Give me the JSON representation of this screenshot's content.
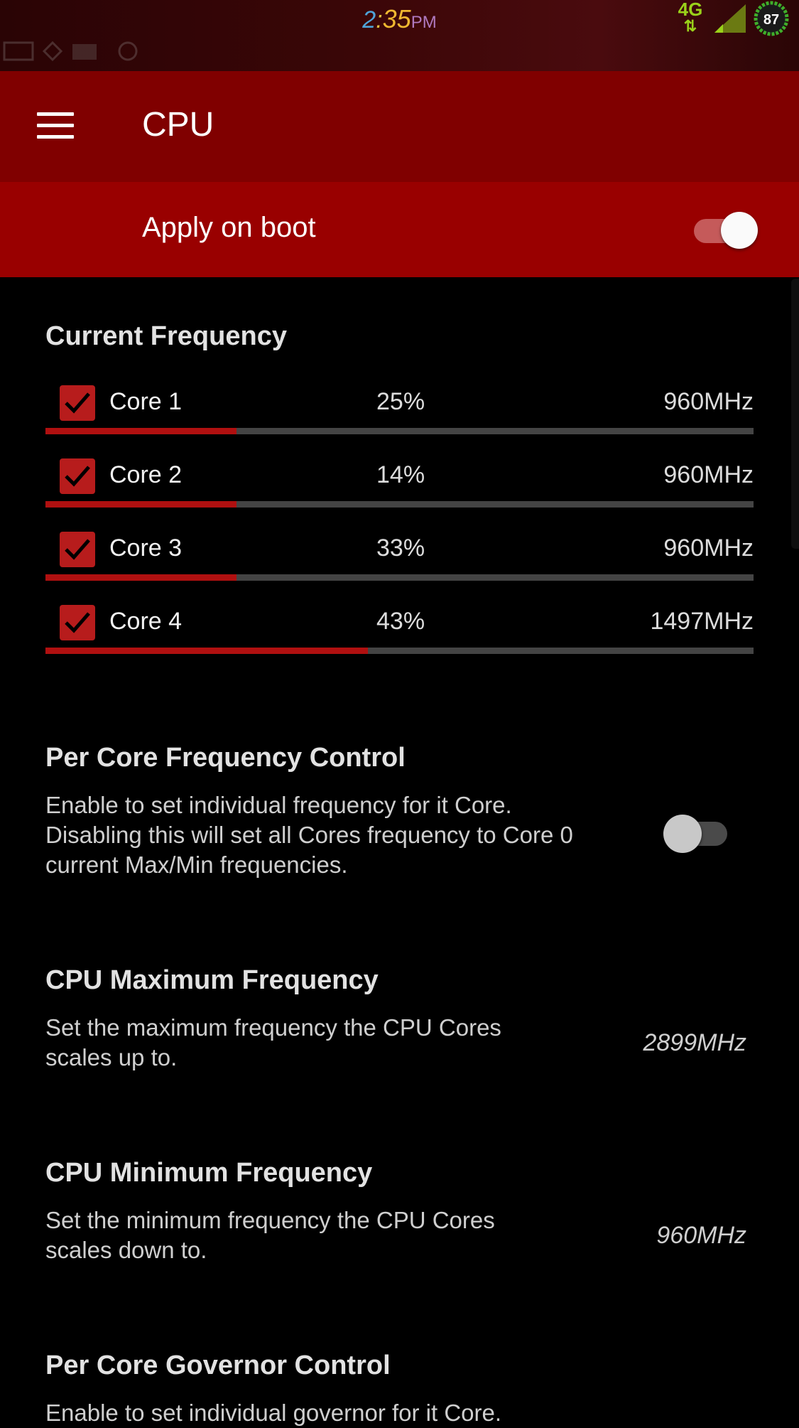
{
  "status_bar": {
    "time_hour": "2",
    "time_colon": ":",
    "time_minutes": "35",
    "time_ampm": "PM",
    "network": "4G",
    "network_arrows": "⇅",
    "battery_level": "87",
    "colors": {
      "net": "#9ad21a",
      "battery_ring": "#3fae2a"
    }
  },
  "toolbar": {
    "title": "CPU",
    "menu_icon": "hamburger-icon"
  },
  "apply_on_boot": {
    "label": "Apply on boot",
    "enabled": true
  },
  "current_frequency": {
    "title": "Current Frequency",
    "cores": [
      {
        "name": "Core 1",
        "percent": "25%",
        "freq": "960MHz",
        "bar_fraction": 0.27,
        "checked": true
      },
      {
        "name": "Core 2",
        "percent": "14%",
        "freq": "960MHz",
        "bar_fraction": 0.27,
        "checked": true
      },
      {
        "name": "Core 3",
        "percent": "33%",
        "freq": "960MHz",
        "bar_fraction": 0.27,
        "checked": true
      },
      {
        "name": "Core 4",
        "percent": "43%",
        "freq": "1497MHz",
        "bar_fraction": 0.455,
        "checked": true
      }
    ]
  },
  "per_core_freq": {
    "title": "Per Core Frequency Control",
    "desc_lines": [
      "Enable to set individual frequency for it Core.",
      "Disabling this will set all Cores frequency to Core 0",
      "current Max/Min frequencies."
    ],
    "enabled": false
  },
  "cpu_max": {
    "title": "CPU Maximum Frequency",
    "desc_lines": [
      "Set the maximum frequency the CPU Cores",
      "scales up to."
    ],
    "value": "2899MHz"
  },
  "cpu_min": {
    "title": "CPU Minimum Frequency",
    "desc_lines": [
      "Set the minimum frequency the CPU Cores",
      "scales down to."
    ],
    "value": "960MHz"
  },
  "per_core_gov": {
    "title": "Per Core Governor Control",
    "desc_lines": [
      "Enable to set individual governor for it Core."
    ]
  },
  "colors": {
    "toolbar": "#800000",
    "boot_row": "#990000",
    "accent": "#b01010"
  }
}
